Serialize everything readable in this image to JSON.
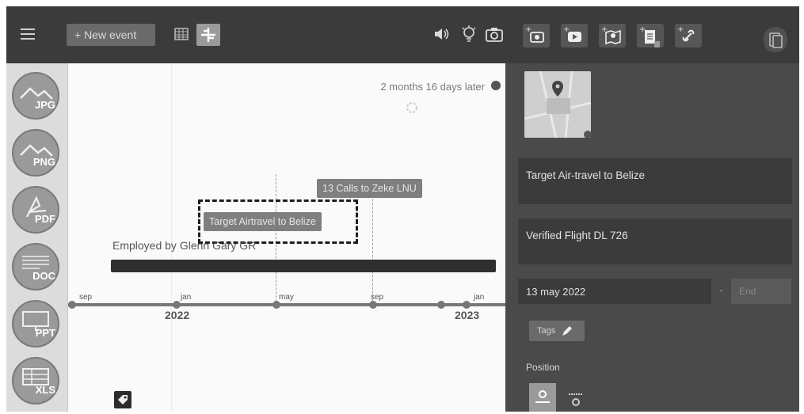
{
  "toolbar": {
    "menu_icon": "hamburger-icon",
    "new_event_label": "+ New event",
    "views": [
      "calendar-grid-icon",
      "timeline-view-icon"
    ],
    "active_view": "timeline",
    "center_icons": [
      "speaker-icon",
      "lightbulb-icon",
      "camera-icon"
    ],
    "share_icons": [
      "add-photo-icon",
      "add-video-icon",
      "add-map-icon",
      "add-document-icon",
      "add-link-icon"
    ],
    "copy_icon": "copy-icon"
  },
  "sidebar": {
    "formats": [
      {
        "label": "JPG",
        "icon": "image-file-icon"
      },
      {
        "label": "PNG",
        "icon": "image-file-icon"
      },
      {
        "label": "PDF",
        "icon": "pdf-file-icon"
      },
      {
        "label": "DOC",
        "icon": "doc-file-icon"
      },
      {
        "label": "PPT",
        "icon": "ppt-file-icon"
      },
      {
        "label": "XLS",
        "icon": "xls-file-icon"
      }
    ]
  },
  "timeline": {
    "later_text": "2 months 16 days later",
    "events": [
      {
        "label": "13 Calls to Zeke LNU"
      },
      {
        "label": "Target Airtravel to Belize",
        "selected": true
      }
    ],
    "employed_label": "Employed by Glenn Gary GR",
    "ticks": [
      "sep",
      "jan",
      "may",
      "sep",
      "jan"
    ],
    "years": [
      "2022",
      "2023"
    ]
  },
  "editor": {
    "title": "Target Air-travel to Belize",
    "description": "Verified Flight DL 726",
    "start_date": "13 may 2022",
    "date_separator": "-",
    "end_placeholder": "End",
    "tags_label": "Tags",
    "position_label": "Position",
    "position_options": [
      "above-icon",
      "below-icon"
    ],
    "position_selected": "above"
  },
  "colors": {
    "topbar": "#3b3b3b",
    "panel": "#4a4a4a",
    "canvas": "#fafafa",
    "sidebar": "#dcdcdc"
  }
}
